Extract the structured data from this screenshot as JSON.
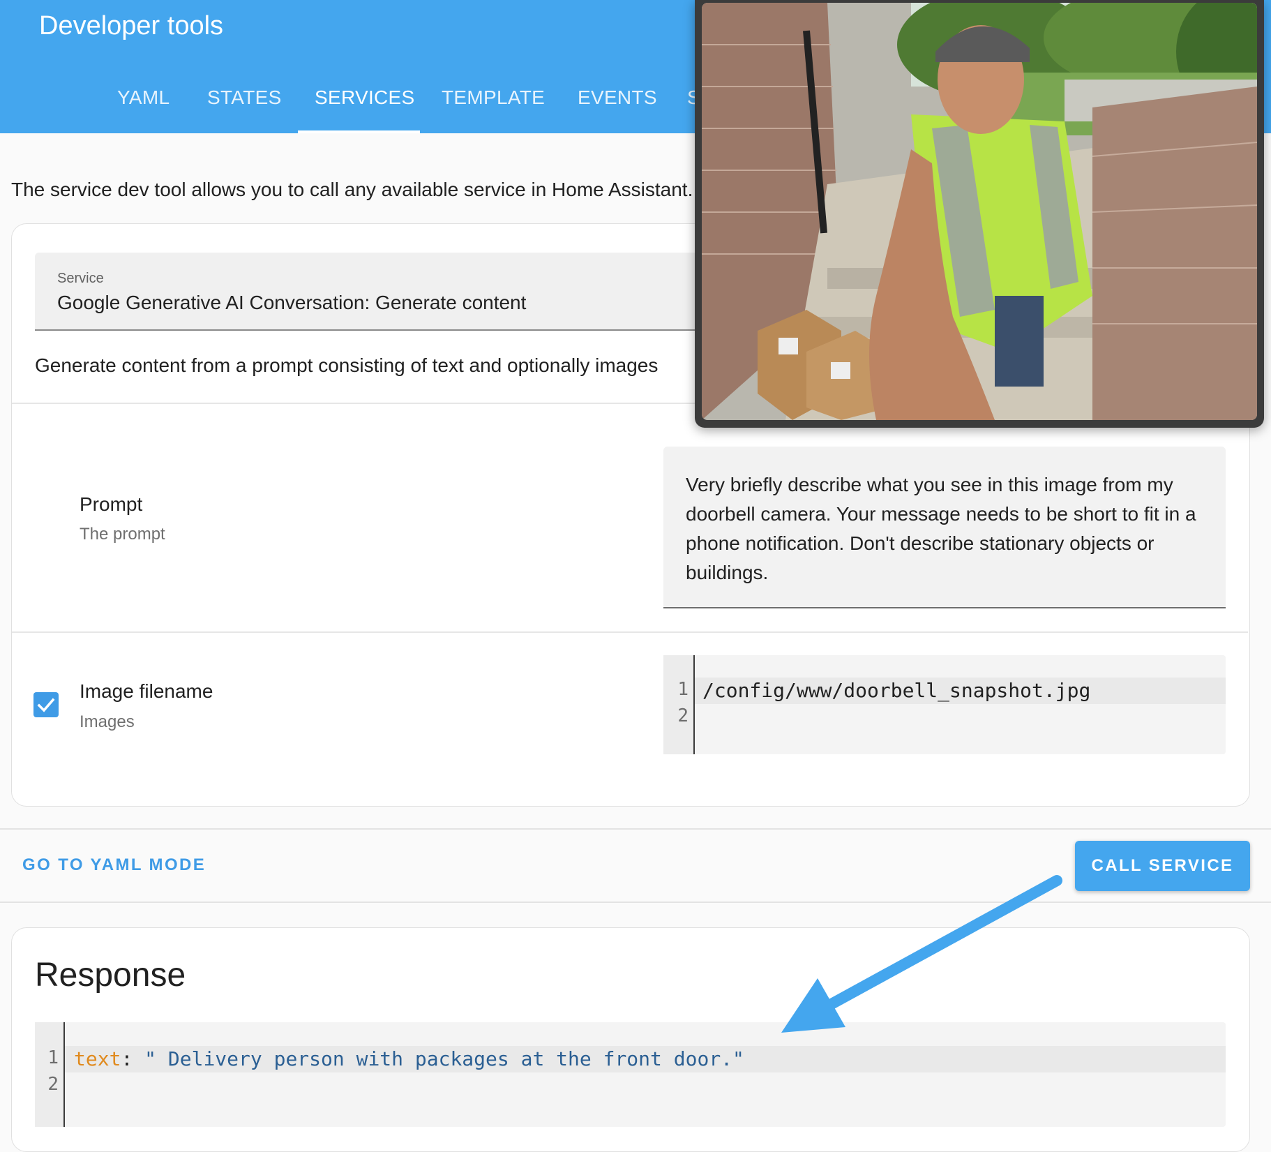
{
  "header": {
    "title": "Developer tools",
    "tabs": [
      {
        "label": "YAML",
        "active": false
      },
      {
        "label": "STATES",
        "active": false
      },
      {
        "label": "SERVICES",
        "active": true
      },
      {
        "label": "TEMPLATE",
        "active": false
      },
      {
        "label": "EVENTS",
        "active": false
      },
      {
        "label": "S",
        "active": false
      }
    ]
  },
  "intro": "The service dev tool allows you to call any available service in Home Assistant.",
  "service": {
    "label": "Service",
    "value": "Google Generative AI Conversation: Generate content",
    "description": "Generate content from a prompt consisting of text and optionally images"
  },
  "fields": {
    "prompt": {
      "title": "Prompt",
      "subtitle": "The prompt",
      "value": "Very briefly describe what you see in this image from my doorbell camera. Your message needs to be short to fit in a phone notification. Don't describe stationary objects or buildings."
    },
    "image_filename": {
      "title": "Image filename",
      "subtitle": "Images",
      "checked": true,
      "line_numbers": [
        "1",
        "2"
      ],
      "value": "/config/www/doorbell_snapshot.jpg"
    }
  },
  "actions": {
    "yaml_mode_label": "GO TO YAML MODE",
    "call_service_label": "CALL SERVICE"
  },
  "response": {
    "title": "Response",
    "line_numbers": [
      "1",
      "2"
    ],
    "key": "text",
    "separator": ": ",
    "value": "\" Delivery person with packages at the front door.\""
  },
  "colors": {
    "header": "#44a6ee",
    "accent": "#3f9be6",
    "yaml_key": "#e08a1e",
    "yaml_string": "#2b5f93"
  }
}
